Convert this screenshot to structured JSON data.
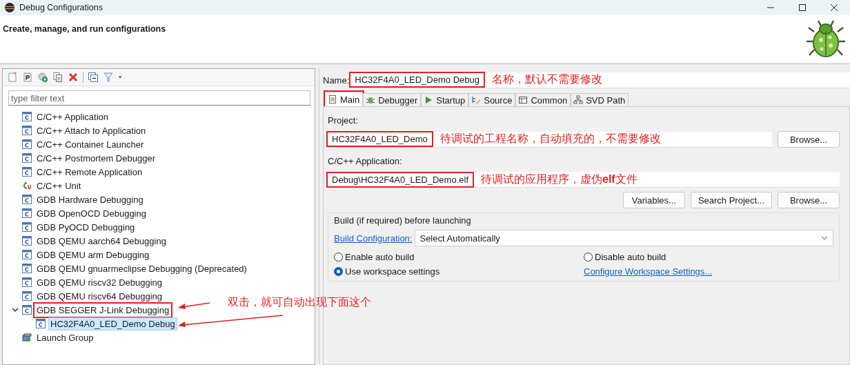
{
  "window": {
    "title": "Debug Configurations"
  },
  "header": {
    "title": "Create, manage, and run configurations"
  },
  "left_panel": {
    "filter": {
      "placeholder": "type filter text"
    },
    "tree": [
      {
        "label": "C/C++ Application",
        "kind": "config",
        "selected": false,
        "highlighted": false
      },
      {
        "label": "C/C++ Attach to Application",
        "kind": "config",
        "selected": false,
        "highlighted": false
      },
      {
        "label": "C/C++ Container Launcher",
        "kind": "config",
        "selected": false,
        "highlighted": false
      },
      {
        "label": "C/C++ Postmortem Debugger",
        "kind": "config",
        "selected": false,
        "highlighted": false
      },
      {
        "label": "C/C++ Remote Application",
        "kind": "config",
        "selected": false,
        "highlighted": false
      },
      {
        "label": "C/C++ Unit",
        "kind": "unit",
        "selected": false,
        "highlighted": false
      },
      {
        "label": "GDB Hardware Debugging",
        "kind": "config",
        "selected": false,
        "highlighted": false
      },
      {
        "label": "GDB OpenOCD Debugging",
        "kind": "config",
        "selected": false,
        "highlighted": false
      },
      {
        "label": "GDB PyOCD Debugging",
        "kind": "config",
        "selected": false,
        "highlighted": false
      },
      {
        "label": "GDB QEMU aarch64 Debugging",
        "kind": "config",
        "selected": false,
        "highlighted": false
      },
      {
        "label": "GDB QEMU arm Debugging",
        "kind": "config",
        "selected": false,
        "highlighted": false
      },
      {
        "label": "GDB QEMU gnuarmeclipse Debugging (Deprecated)",
        "kind": "config",
        "selected": false,
        "highlighted": false
      },
      {
        "label": "GDB QEMU riscv32 Debugging",
        "kind": "config",
        "selected": false,
        "highlighted": false
      },
      {
        "label": "GDB QEMU riscv64 Debugging",
        "kind": "config",
        "selected": false,
        "highlighted": false
      },
      {
        "label": "GDB SEGGER J-Link Debugging",
        "kind": "config",
        "selected": false,
        "highlighted": true,
        "expanded": true,
        "children": [
          {
            "label": "HC32F4A0_LED_Demo Debug",
            "kind": "config",
            "selected": true,
            "highlighted": false
          }
        ]
      },
      {
        "label": "Launch Group",
        "kind": "group",
        "selected": false,
        "highlighted": false
      }
    ],
    "note": "双击，就可自动出现下面这个"
  },
  "right_panel": {
    "name": {
      "label": "Name:",
      "value": "HC32F4A0_LED_Demo Debug",
      "highlighted": true,
      "note": "名称，默认不需要修改"
    },
    "tabs": [
      {
        "label": "Main",
        "kind": "main",
        "selected": true,
        "highlighted": true
      },
      {
        "label": "Debugger",
        "kind": "debugger",
        "selected": false,
        "highlighted": false
      },
      {
        "label": "Startup",
        "kind": "startup",
        "selected": false,
        "highlighted": false
      },
      {
        "label": "Source",
        "kind": "source",
        "selected": false,
        "highlighted": false
      },
      {
        "label": "Common",
        "kind": "common",
        "selected": false,
        "highlighted": false
      },
      {
        "label": "SVD Path",
        "kind": "svd",
        "selected": false,
        "highlighted": false
      }
    ],
    "project": {
      "label": "Project:",
      "value": "HC32F4A0_LED_Demo",
      "highlighted": true,
      "note": "待调试的工程名称，自动填充的，不需要修改",
      "button": "Browse..."
    },
    "application": {
      "label": "C/C++ Application:",
      "value": "Debug\\HC32F4A0_LED_Demo.elf",
      "highlighted": true,
      "note": "待调试的应用程序，虚伪**elf**文件",
      "buttons": [
        "Variables...",
        "Search Project...",
        "Browse..."
      ]
    },
    "build": {
      "title": "Build (if required) before launching",
      "config_link": "Build Configuration:",
      "config_value": "Select Automatically",
      "options": [
        {
          "label": "Enable auto build",
          "selected": false
        },
        {
          "label": "Disable auto build",
          "selected": false
        },
        {
          "label": "Use workspace settings",
          "selected": true
        }
      ],
      "workspace_link": "Configure Workspace Settings..."
    }
  }
}
